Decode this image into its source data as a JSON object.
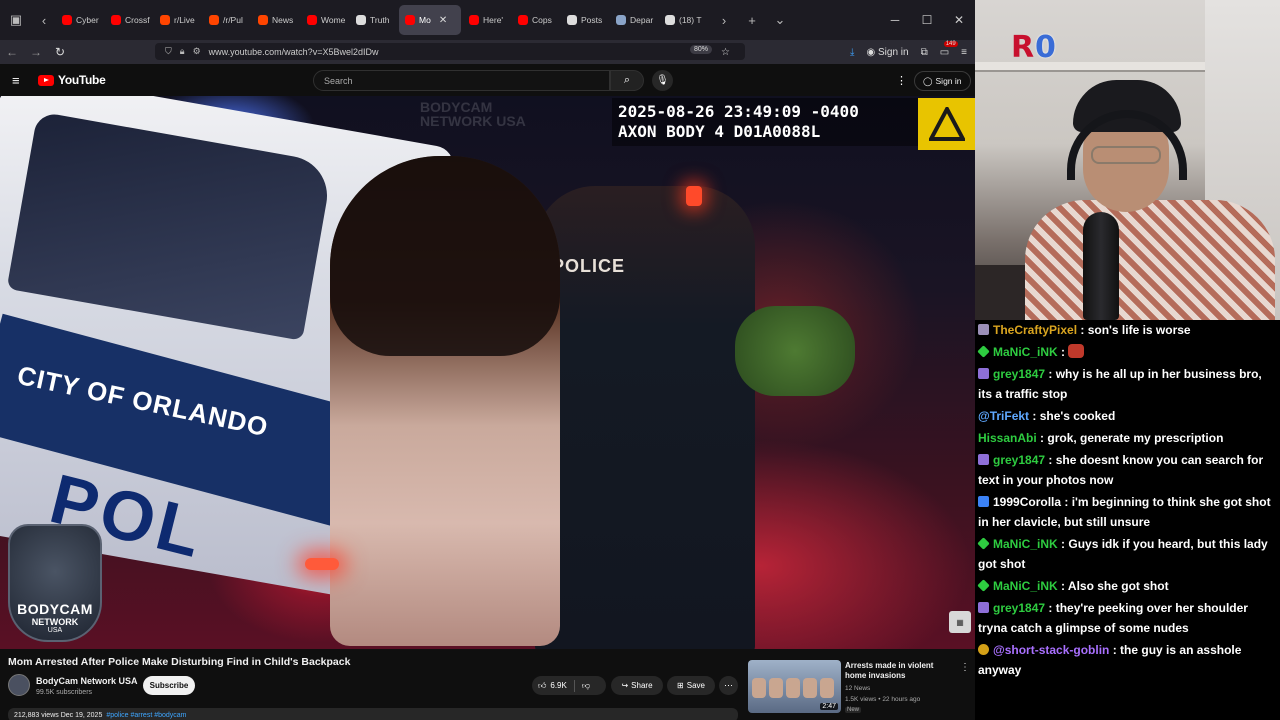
{
  "browser": {
    "tabs": [
      {
        "label": "Cyber",
        "favicon_color": "#ff0000",
        "active": false
      },
      {
        "label": "Crossf",
        "favicon_color": "#ff0000",
        "active": false
      },
      {
        "label": "r/Live",
        "favicon_color": "#ff4500",
        "active": false
      },
      {
        "label": "/r/Pul",
        "favicon_color": "#ff4500",
        "active": false
      },
      {
        "label": "News",
        "favicon_color": "#ff4500",
        "active": false
      },
      {
        "label": "Wome",
        "favicon_color": "#ff0000",
        "active": false
      },
      {
        "label": "Truth",
        "favicon_color": "#dddddd",
        "active": false
      },
      {
        "label": "Mo",
        "favicon_color": "#ff0000",
        "active": true
      },
      {
        "label": "Here'",
        "favicon_color": "#ff0000",
        "active": false
      },
      {
        "label": "Cops",
        "favicon_color": "#ff0000",
        "active": false
      },
      {
        "label": "Posts",
        "favicon_color": "#dddddd",
        "active": false
      },
      {
        "label": "Depar",
        "favicon_color": "#8aa4c8",
        "active": false
      },
      {
        "label": "(18) T",
        "favicon_color": "#dddddd",
        "active": false
      }
    ],
    "url": "www.youtube.com/watch?v=X5Bwel2dIDw",
    "zoom": "80%",
    "sign_in": "Sign in",
    "badge_count": "149"
  },
  "youtube": {
    "logo": "YouTube",
    "search_placeholder": "Search",
    "sign_in": "Sign in",
    "overlay": {
      "timestamp_line1": "2025-08-26 23:49:09 -0400",
      "timestamp_line2": "AXON BODY 4 D01A0088L",
      "car_text": "CITY OF ORLANDO",
      "car_pol": "POL",
      "police_label": "POLICE",
      "channel_badge": [
        "BODYCAM",
        "NETWORK",
        "USA"
      ],
      "watermark": "BODYCAM NETWORK USA"
    },
    "video": {
      "title": "Mom Arrested After Police Make Disturbing Find in Child's Backpack",
      "channel": "BodyCam Network USA",
      "subscribers": "99.5K subscribers",
      "subscribe": "Subscribe",
      "likes": "6.9K",
      "share": "Share",
      "save": "Save",
      "views_date": "212,883 views  Dec 19, 2025",
      "tags": "#police #arrest #bodycam"
    },
    "recommended": {
      "title": "Arrests made in violent home invasions",
      "channel": "12 News",
      "meta": "1.5K views • 22 hours ago",
      "badge": "New",
      "duration": "2:47"
    }
  },
  "webcam": {
    "sub_icon": "R",
    "sub_count": "0"
  },
  "chat": [
    {
      "badge_color": "#9b8fb8",
      "user": "TheCraftyPixel",
      "user_color": "#daa520",
      "text": ": son's life is worse"
    },
    {
      "badge_color": "#2ecc40",
      "badge_shape": "diamond",
      "user": "MaNiC_iNK",
      "user_color": "#2ecc40",
      "text": ":",
      "emote": true
    },
    {
      "badge_color": "#8e6fd8",
      "user": "grey1847",
      "user_color": "#2ecc40",
      "text": ": why is he all up in her business bro, its a traffic stop"
    },
    {
      "badge_color": "",
      "user": "@TriFekt",
      "user_color": "#5fa8ff",
      "text": ": she's cooked"
    },
    {
      "badge_color": "",
      "user": "HissanAbi",
      "user_color": "#2ecc40",
      "text": ": grok, generate my prescription"
    },
    {
      "badge_color": "#8e6fd8",
      "user": "grey1847",
      "user_color": "#2ecc40",
      "text": ": she doesnt know you can search for text in your photos now"
    },
    {
      "badge_color": "#3b82f6",
      "user": "1999Corolla",
      "user_color": "#ffffff",
      "text": ": i'm beginning to think she got shot in her clavicle, but still unsure"
    },
    {
      "badge_color": "#2ecc40",
      "badge_shape": "diamond",
      "user": "MaNiC_iNK",
      "user_color": "#2ecc40",
      "text": ": Guys idk if you heard, but this lady got shot"
    },
    {
      "badge_color": "#2ecc40",
      "badge_shape": "diamond",
      "user": "MaNiC_iNK",
      "user_color": "#2ecc40",
      "text": ": Also she got shot"
    },
    {
      "badge_color": "#8e6fd8",
      "user": "grey1847",
      "user_color": "#2ecc40",
      "text": ": they're peeking over her shoulder tryna catch a glimpse of some nudes"
    },
    {
      "badge_color": "#d4a017",
      "badge_shape": "circle",
      "user": "@short-stack-goblin",
      "user_color": "#a970ff",
      "text": ": the guy is an asshole anyway"
    }
  ]
}
